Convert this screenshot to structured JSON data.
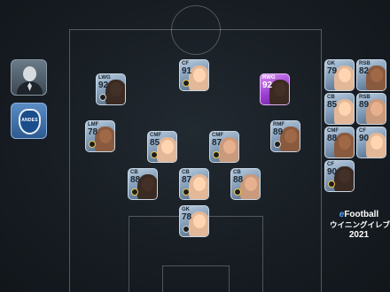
{
  "title_logo": {
    "brand": "Football",
    "brand_mark": "e",
    "japanese": "ウイニングイレブン",
    "year": "2021"
  },
  "manager": {
    "icon": "manager-silhouette-icon"
  },
  "team": {
    "crest_text": "ANDES",
    "icon": "team-crest-icon"
  },
  "colors": {
    "card": "#7c97b3",
    "featured_card": "#9b3ed0",
    "pitch_line": "#ffffff"
  },
  "starters": [
    {
      "pos": "CF",
      "rating": "91",
      "featured": false
    },
    {
      "pos": "LWG",
      "rating": "92",
      "featured": false
    },
    {
      "pos": "RWG",
      "rating": "92",
      "featured": true
    },
    {
      "pos": "LMF",
      "rating": "78",
      "featured": false
    },
    {
      "pos": "CMF",
      "rating": "85",
      "featured": false
    },
    {
      "pos": "CMF",
      "rating": "87",
      "featured": false
    },
    {
      "pos": "RMF",
      "rating": "89",
      "featured": false
    },
    {
      "pos": "CB",
      "rating": "88",
      "featured": false
    },
    {
      "pos": "CB",
      "rating": "87",
      "featured": false
    },
    {
      "pos": "CB",
      "rating": "88",
      "featured": false
    },
    {
      "pos": "GK",
      "rating": "78",
      "featured": false
    }
  ],
  "bench": [
    {
      "pos": "GK",
      "rating": "79"
    },
    {
      "pos": "RSB",
      "rating": "82"
    },
    {
      "pos": "CB",
      "rating": "85"
    },
    {
      "pos": "RSB",
      "rating": "89"
    },
    {
      "pos": "CMF",
      "rating": "88"
    },
    {
      "pos": "CF",
      "rating": "90"
    },
    {
      "pos": "CF",
      "rating": "90"
    }
  ]
}
